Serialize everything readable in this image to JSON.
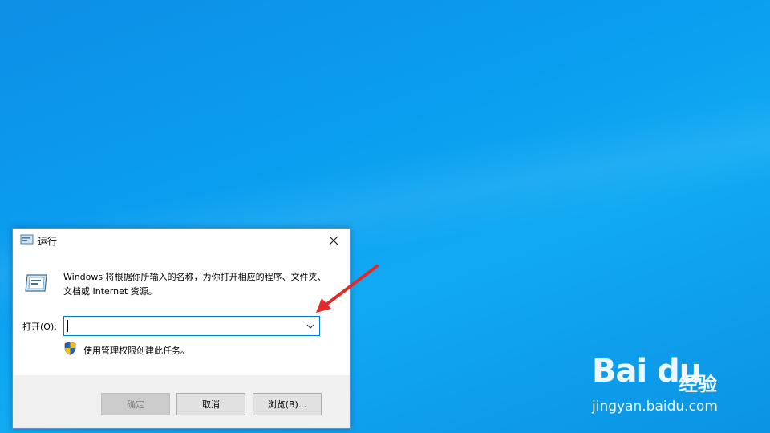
{
  "dialog": {
    "title": "运行",
    "description": "Windows 将根据你所输入的名称，为你打开相应的程序、文件夹、文档或 Internet 资源。",
    "open_label": "打开(O):",
    "input_value": "",
    "admin_note": "使用管理权限创建此任务。",
    "buttons": {
      "ok": "确定",
      "cancel": "取消",
      "browse": "浏览(B)..."
    },
    "icons": {
      "title": "run-icon",
      "close": "close-icon",
      "dropdown": "chevron-down-icon",
      "shield": "shield-icon"
    }
  },
  "watermark": {
    "logo": "Bai du",
    "suffix": "经验",
    "url": "jingyan.baidu.com"
  },
  "colors": {
    "desktop": "#0a9df0",
    "focus_border": "#0078d7",
    "annotation_arrow": "#e02b2b"
  }
}
